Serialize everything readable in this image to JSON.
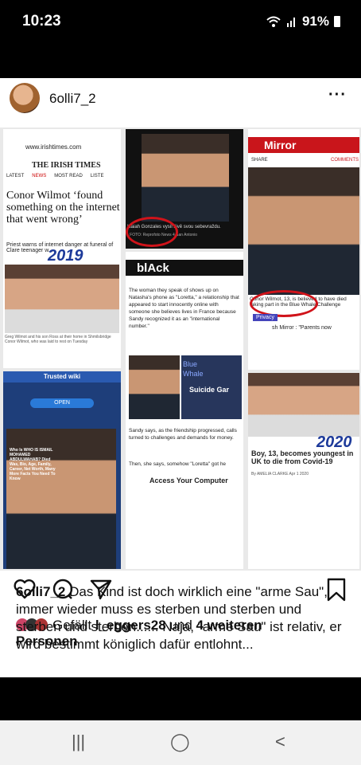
{
  "status": {
    "time": "10:23",
    "battery": "91%"
  },
  "post": {
    "username": "6olli7_2",
    "collage": {
      "irish": {
        "url": "www.irishtimes.com",
        "masthead": "THE IRISH TIMES",
        "tabs": [
          "LATEST",
          "NEWS",
          "MOST READ",
          "LISTE"
        ],
        "headline": "Conor Wilmot ‘found something on the internet that went wrong’",
        "sub": "Priest warns of internet danger at funeral of Clare teenager w... ",
        "handnote": "2019",
        "photo_caption": "Greg Wilmot and his son Ross at their home in Shmilsbridge Conor Wilmot, who was laid to rest on Tuesday"
      },
      "czech": {
        "caption": "Isaiah Gonzales vysíl živě svou sebevraždu.",
        "credit": "• FOTO: Reprofoto News 4 San Antonio"
      },
      "black": {
        "logo": "blAck",
        "text1": "The woman they speak of shows up on Natasha's phone as \"Loretta,\" a relationship that appeared to start innocently online with someone she believes lives in France because Sandy recognized it as an \"international number.\"",
        "overlay1": "Blue",
        "overlay2": "Whale",
        "overlay3": "Suicide Gar",
        "text2": "Sandy says, as the friendship progressed, calls turned to challenges and demands for money.",
        "text3": "Then, she says, somehow \"Loretta\" got he",
        "link": "Access Your Computer"
      },
      "mirror": {
        "logo": "Mirror",
        "share": "SHARE",
        "comments": "COMMENTS",
        "caption": "Conor Wilmot, 13, is believed to have died taking part in the Blue Whale Challenge",
        "privacy": "Privacy",
        "source": "sh Mirror : \"Parents now",
        "handnote": "2020",
        "headline": "Boy, 13, becomes youngest in UK to die from Covid-19",
        "byline": "By AMELIA CLARKE  Apr 1 2020"
      },
      "trusted": {
        "title": "Trusted wiki",
        "open": "OPEN",
        "caption": "Who Is WHO IS ISMAIL MOHAMED ABDULWAHAB? Died Was, Bio, Age, Family, Career, Net Worth, Many More Facts You Need To Know"
      }
    },
    "likes": {
      "prefix": "Gefällt ",
      "user": "l_eggers28",
      "middle": " und ",
      "others": "4 weiteren",
      "suffix": "Personen"
    },
    "caption": {
      "user": "6olli7_2",
      "text": " Das Kind ist doch wirklich eine \"arme Sau\", immer wieder muss es sterben und sterben und sterben und sterben...... Naja, \"arme Sau\"  ist relativ, er wird bestimmt königlich dafür entlohnt..."
    }
  },
  "nav": {
    "recent": "|||",
    "home": "◯",
    "back": "<"
  }
}
